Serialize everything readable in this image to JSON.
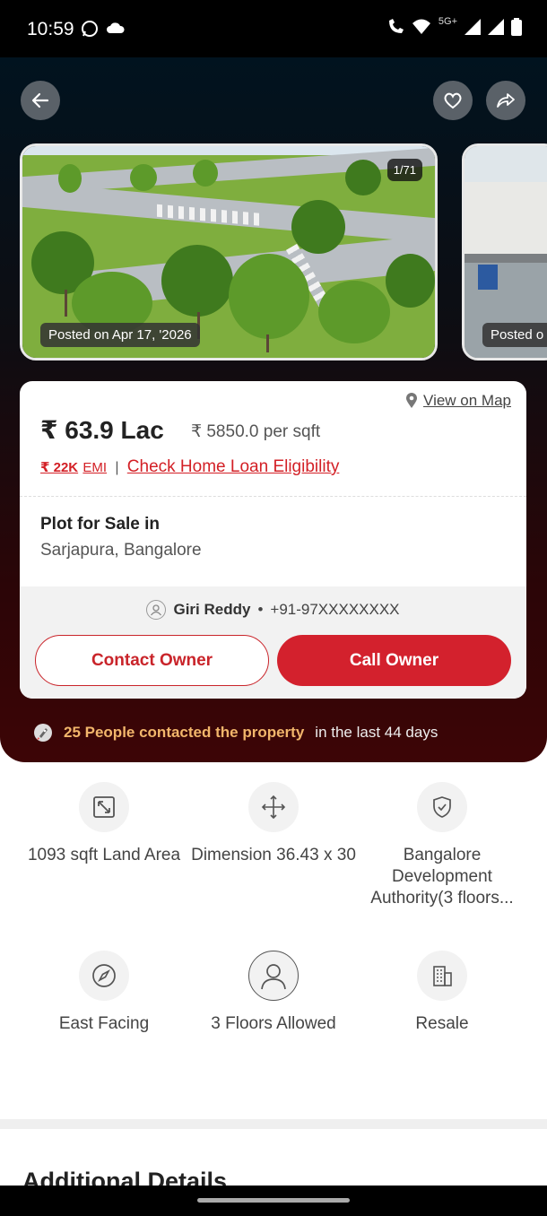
{
  "status_bar": {
    "time": "10:59",
    "network": "5G+"
  },
  "gallery": {
    "counter": "1/71",
    "posted_main": "Posted on Apr 17, '2026",
    "posted_next": "Posted o"
  },
  "card": {
    "view_on_map": "View on Map",
    "price": "₹ 63.9 Lac",
    "price_per_sqft": "₹ 5850.0 per sqft",
    "emi_amount": "₹ 22K",
    "emi_label": "EMI",
    "emi_separator": "|",
    "loan_link": "Check Home Loan Eligibility",
    "property_type": "Plot for Sale in",
    "location": "Sarjapura, Bangalore",
    "owner_name": "Giri Reddy",
    "owner_dot": "•",
    "owner_phone": "+91-97XXXXXXXX",
    "contact_button": "Contact Owner",
    "call_button": "Call Owner"
  },
  "contacted": {
    "highlight": "25 People contacted the property",
    "rest": "in the last 44 days"
  },
  "features": [
    {
      "icon": "expand-area-icon",
      "label": "1093 sqft Land Area"
    },
    {
      "icon": "move-arrows-icon",
      "label": "Dimension 36.43 x 30"
    },
    {
      "icon": "shield-check-icon",
      "label": "Bangalore Development Authority(3 floors..."
    },
    {
      "icon": "compass-icon",
      "label": "East Facing"
    },
    {
      "icon": "person-icon",
      "label": "3 Floors Allowed"
    },
    {
      "icon": "building-icon",
      "label": "Resale"
    }
  ],
  "section": {
    "title": "Additional Details"
  },
  "colors": {
    "accent": "#d3212d",
    "highlight": "#f2b66b",
    "hero_dark": "#01131f",
    "hero_red": "#3d0506"
  }
}
